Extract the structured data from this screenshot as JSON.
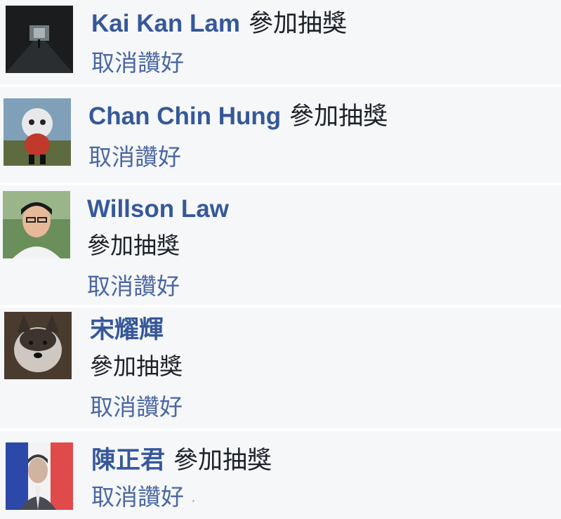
{
  "comments": [
    {
      "author": "Kai Kan Lam",
      "text": "參加抽獎",
      "action": "取消讚好"
    },
    {
      "author": "Chan Chin Hung",
      "text": "參加抽獎",
      "action": "取消讚好"
    },
    {
      "author": "Willson Law",
      "text": "參加抽獎",
      "action": "取消讚好"
    },
    {
      "author": "宋耀輝",
      "text": "參加抽獎",
      "action": "取消讚好"
    },
    {
      "author": "陳正君",
      "text": "參加抽獎",
      "action": "取消讚好",
      "trailing": "·"
    }
  ],
  "colors": {
    "name_link": "#365899",
    "action_link": "#4b67a1",
    "comment_text": "#1d2129",
    "row_background": "#f6f7f9"
  },
  "icons": [
    "avatar-tunnel",
    "avatar-mascot",
    "avatar-person",
    "avatar-dog",
    "avatar-french-flag"
  ]
}
